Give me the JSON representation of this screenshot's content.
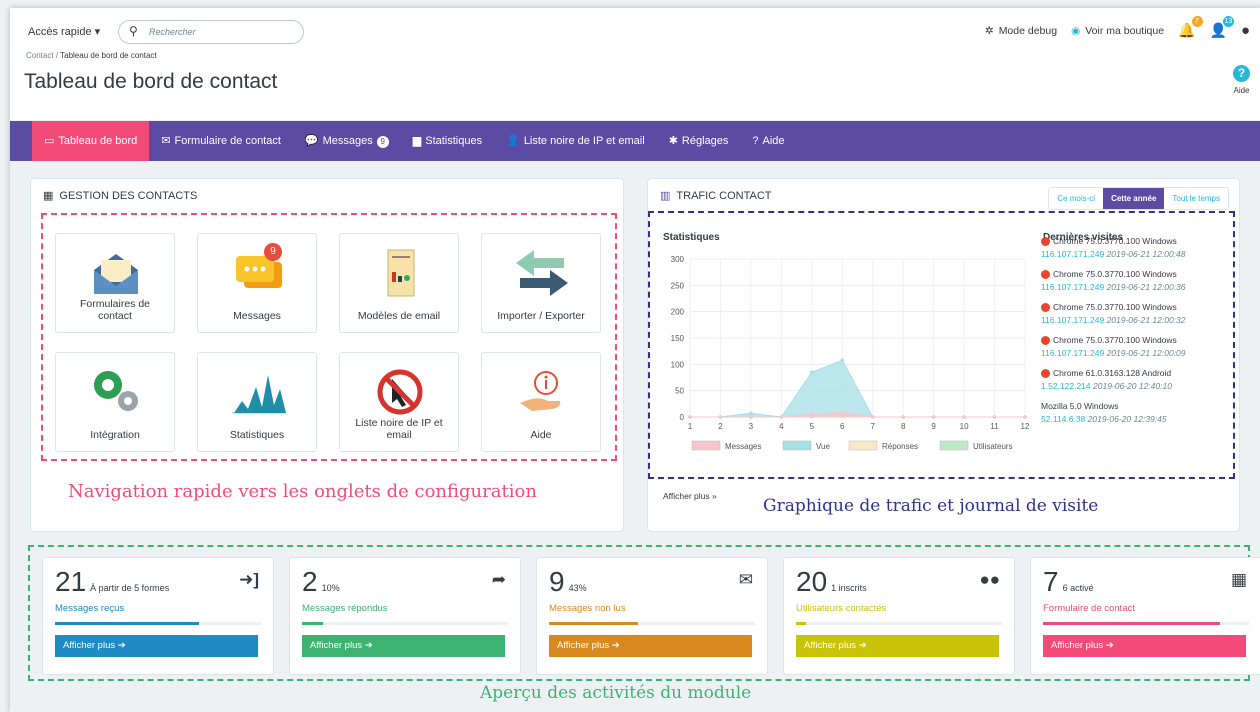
{
  "header": {
    "quick_access": "Accès rapide ▾",
    "search_placeholder": "Rechercher",
    "breadcrumb_root": "Contact",
    "breadcrumb_sep": "/",
    "breadcrumb_current": "Tableau de bord de contact",
    "title": "Tableau de bord de contact",
    "debug": "Mode debug",
    "view_shop": "Voir ma boutique",
    "badge_orders": "7",
    "badge_customers": "13",
    "help": "Aide"
  },
  "nav": {
    "items": [
      {
        "icon": "▭",
        "label": "Tableau de bord"
      },
      {
        "icon": "✉",
        "label": "Formulaire de contact"
      },
      {
        "icon": "💬",
        "label": "Messages",
        "badge": "9"
      },
      {
        "icon": "▆",
        "label": "Statistiques"
      },
      {
        "icon": "👤",
        "label": "Liste noire de IP et email"
      },
      {
        "icon": "✱",
        "label": "Réglages"
      },
      {
        "icon": "?",
        "label": "Aide"
      }
    ]
  },
  "contacts": {
    "title": "Gestion des contacts",
    "tiles": [
      "Formulaires de contact",
      "Messages",
      "Modèles de email",
      "Importer / Exporter",
      "Intégration",
      "Statistiques",
      "Liste noire de IP et email",
      "Aide"
    ],
    "message_badge": "9",
    "caption": "Navigation rapide vers les onglets de configuration"
  },
  "traffic": {
    "title": "Trafic contact",
    "periods": [
      "Ce mois-ci",
      "Cette année",
      "Tout le temps"
    ],
    "stats_label": "Statistiques",
    "visits_label": "Dernières visites",
    "visits": [
      {
        "ua": "Chrome 75.0.3770.100 Windows",
        "ip": "116.107.171.249",
        "time": "2019-06-21 12:00:48"
      },
      {
        "ua": "Chrome 75.0.3770.100 Windows",
        "ip": "116.107.171.249",
        "time": "2019-06-21 12:00:36"
      },
      {
        "ua": "Chrome 75.0.3770.100 Windows",
        "ip": "116.107.171.249",
        "time": "2019-06-21 12:00:32"
      },
      {
        "ua": "Chrome 75.0.3770.100 Windows",
        "ip": "116.107.171.249",
        "time": "2019-06-21 12:00:09"
      },
      {
        "ua": "Chrome 61.0.3163.128 Android",
        "ip": "1.52.122.214",
        "time": "2019-06-20 12:40:10"
      },
      {
        "ua": "Mozilla 5.0 Windows",
        "ip": "52.114.6.38",
        "time": "2019-06-20 12:39:45"
      }
    ],
    "more": "Afficher plus »",
    "caption": "Graphique de trafic et journal de visite"
  },
  "chart_data": {
    "type": "area",
    "x": [
      1,
      2,
      3,
      4,
      5,
      6,
      7,
      8,
      9,
      10,
      11,
      12
    ],
    "ylim": [
      0,
      300
    ],
    "yticks": [
      0,
      50,
      100,
      150,
      200,
      250,
      300
    ],
    "series": [
      {
        "name": "Messages",
        "color": "#f7c5cc",
        "values": [
          0,
          0,
          0,
          0,
          5,
          9,
          0,
          0,
          0,
          0,
          0,
          0
        ]
      },
      {
        "name": "Vue",
        "color": "#a6dfe6",
        "values": [
          0,
          0,
          7,
          0,
          85,
          108,
          0,
          0,
          0,
          0,
          0,
          0
        ]
      },
      {
        "name": "Réponses",
        "color": "#fbe7c6",
        "values": [
          0,
          0,
          0,
          0,
          0,
          0,
          0,
          0,
          0,
          0,
          0,
          0
        ]
      },
      {
        "name": "Utilisateurs",
        "color": "#bfe8c4",
        "values": [
          0,
          0,
          0,
          0,
          0,
          0,
          0,
          0,
          0,
          0,
          0,
          0
        ]
      }
    ]
  },
  "stats": [
    {
      "num": "21",
      "sub": "À partir de 5 formes",
      "label": "Messages reçus",
      "more": "Afficher plus ➔",
      "color": "#1e8bc3",
      "progress": 0.7
    },
    {
      "num": "2",
      "sub": "10%",
      "label": "Messages répondus",
      "more": "Afficher plus ➔",
      "color": "#3cb371",
      "progress": 0.1
    },
    {
      "num": "9",
      "sub": "43%",
      "label": "Messages non lus",
      "more": "Afficher plus ➔",
      "color": "#d98a1e",
      "progress": 0.43
    },
    {
      "num": "20",
      "sub": "1 inscrits",
      "label": "Utilisateurs contactés",
      "more": "Afficher plus ➔",
      "color": "#c9c40a",
      "progress": 0.05
    },
    {
      "num": "7",
      "sub": "6 activé",
      "label": "Formulaire de contact",
      "more": "Afficher plus ➔",
      "color": "#f34b79",
      "progress": 0.86
    }
  ],
  "overview_caption": "Aperçu des activités du module"
}
